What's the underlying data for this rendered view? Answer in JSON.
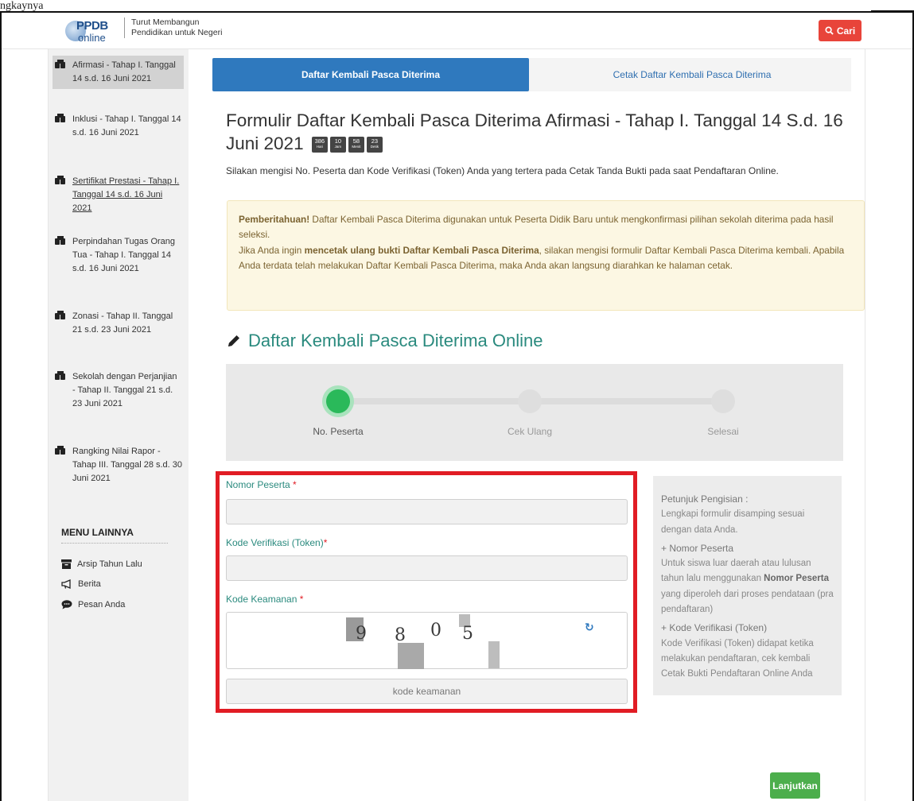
{
  "stray_text": "ngkaynya",
  "header": {
    "logo_ppdb": "PPDB",
    "logo_online": "online",
    "tagline_1": "Turut Membangun",
    "tagline_2": "Pendidikan untuk Negeri",
    "search_label": "Cari"
  },
  "sidebar": {
    "items": [
      {
        "label": "Afirmasi - Tahap I. Tanggal 14 s.d. 16 Juni 2021"
      },
      {
        "label": "Inklusi - Tahap I. Tanggal 14 s.d. 16 Juni 2021"
      },
      {
        "label": "Sertifikat Prestasi - Tahap I. Tanggal 14 s.d. 16 Juni 2021"
      },
      {
        "label": "Perpindahan Tugas Orang Tua - Tahap I. Tanggal 14 s.d. 16 Juni 2021"
      },
      {
        "label": "Zonasi - Tahap II. Tanggal 21 s.d. 23 Juni 2021"
      },
      {
        "label": "Sekolah dengan Perjanjian - Tahap II. Tanggal 21 s.d. 23 Juni 2021"
      },
      {
        "label": "Rangking Nilai Rapor - Tahap III. Tanggal 28 s.d. 30 Juni 2021"
      }
    ],
    "menu_heading": "MENU LAINNYA",
    "menu": [
      {
        "label": "Arsip Tahun Lalu"
      },
      {
        "label": "Berita"
      },
      {
        "label": "Pesan Anda"
      }
    ]
  },
  "tabs": [
    {
      "label": "Daftar Kembali Pasca Diterima"
    },
    {
      "label": "Cetak Daftar Kembali Pasca Diterima"
    }
  ],
  "form": {
    "title": "Formulir Daftar Kembali Pasca Diterima Afirmasi - Tahap I. Tanggal 14 S.d. 16 Juni 2021",
    "timer": [
      {
        "value": "386",
        "unit": "Hari"
      },
      {
        "value": "10",
        "unit": "Jam"
      },
      {
        "value": "58",
        "unit": "Menit"
      },
      {
        "value": "23",
        "unit": "Detik"
      }
    ],
    "intro": "Silakan mengisi No. Peserta dan Kode Verifikasi (Token) Anda yang tertera pada Cetak Tanda Bukti pada saat Pendaftaran Online.",
    "alert_strong": "Pemberitahuan!",
    "alert_p1": " Daftar Kembali Pasca Diterima digunakan untuk Peserta Didik Baru untuk mengkonfirmasi pilihan sekolah diterima pada hasil seleksi.",
    "alert_p2_a": "Jika Anda ingin ",
    "alert_p2_b": "mencetak ulang bukti Daftar Kembali Pasca Diterima",
    "alert_p2_c": ", silakan mengisi formulir Daftar Kembali Pasca Diterima kembali. Apabila Anda terdata telah melakukan Daftar Kembali Pasca Diterima, maka Anda akan langsung diarahkan ke halaman cetak.",
    "section_title": "Daftar Kembali Pasca Diterima Online",
    "steps": [
      {
        "label": "No. Peserta"
      },
      {
        "label": "Cek Ulang"
      },
      {
        "label": "Selesai"
      }
    ],
    "fields": {
      "nomor_label": "Nomor Peserta",
      "nomor_value": "",
      "token_label": "Kode Verifikasi (Token)",
      "token_value": "",
      "captcha_label": "Kode Keamanan",
      "captcha_chars": [
        "9",
        "8",
        "0",
        "5"
      ],
      "captcha_placeholder": "kode keamanan",
      "required_mark": "*"
    },
    "next_label": "Lanjutkan"
  },
  "help": {
    "heading": "Petunjuk Pengisian :",
    "p1": "Lengkapi formulir disamping sesuai dengan data Anda.",
    "h2": "+ Nomor Peserta",
    "p2a": "Untuk siswa luar daerah atau lulusan tahun lalu menggunakan ",
    "p2b": "Nomor Peserta",
    "p2c": " yang diperoleh dari proses pendataan (pra pendaftaran)",
    "h3": "+ Kode Verifikasi (Token)",
    "p3": "Kode Verifikasi (Token) didapat ketika melakukan pendaftaran, cek kembali Cetak Bukti Pendaftaran Online Anda"
  },
  "colors": {
    "primary": "#2f79be",
    "danger": "#e8443a",
    "success": "#4cae4c",
    "teal": "#2a8a7e",
    "highlight_box": "#e11c24"
  }
}
